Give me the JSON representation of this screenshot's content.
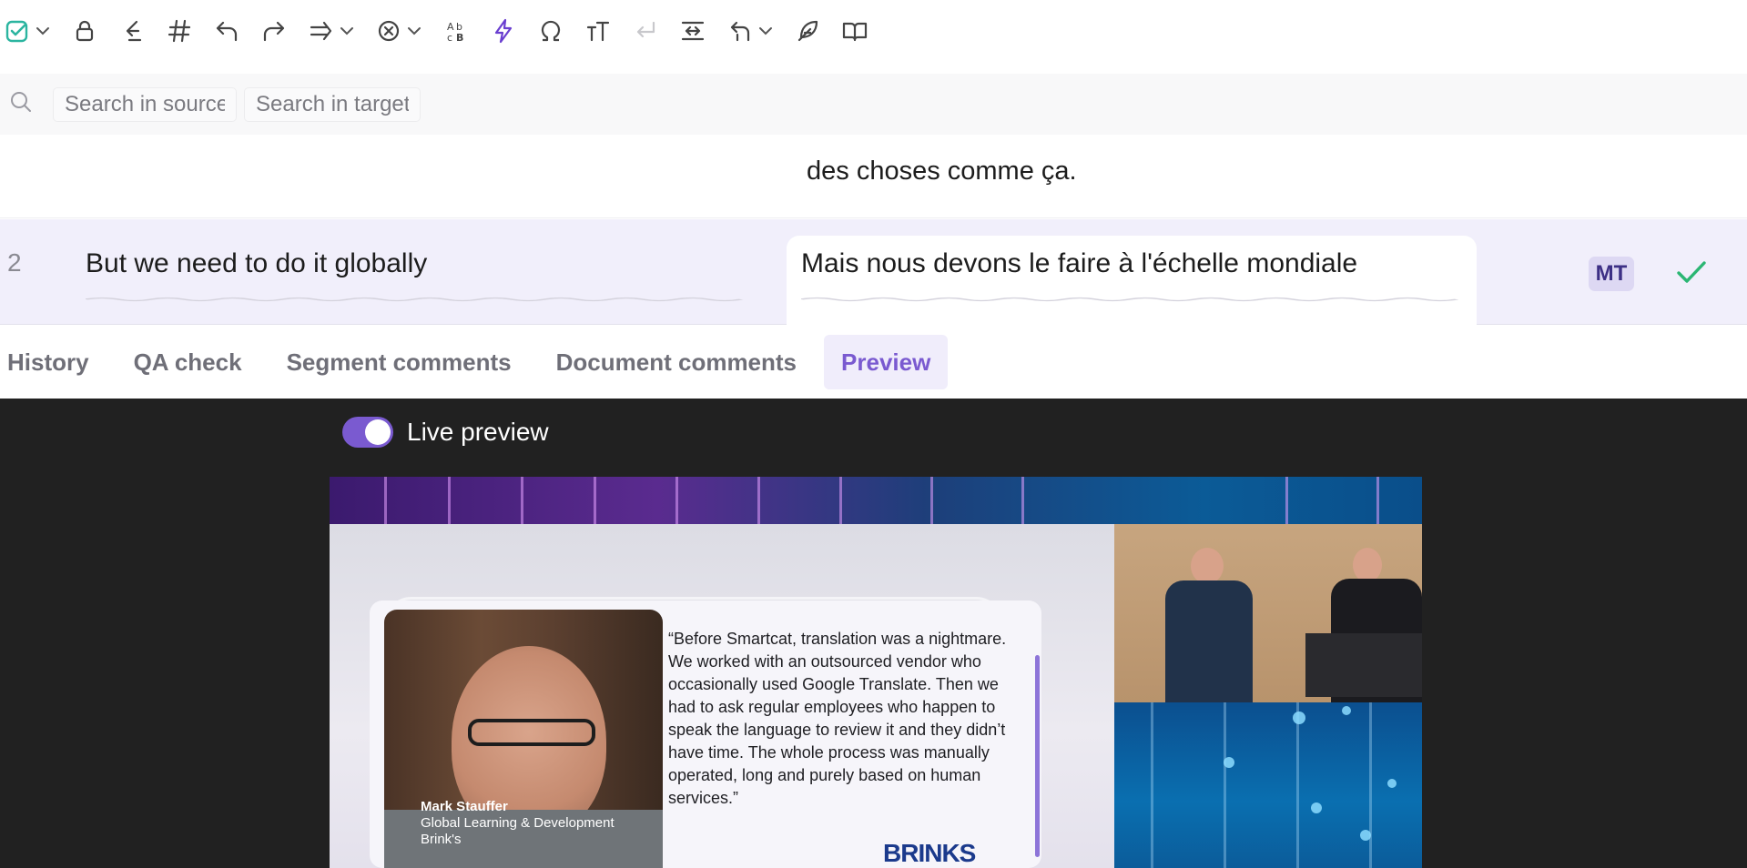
{
  "toolbar": {
    "icons": [
      "confirm-icon",
      "lock-icon",
      "insert-source-icon",
      "hashtag-icon",
      "undo-icon",
      "redo-icon",
      "tags-icon",
      "clear-icon",
      "case-icon",
      "lightning-icon",
      "omega-icon",
      "text-size-icon",
      "line-break-icon",
      "merge-icon",
      "revert-icon",
      "feather-icon",
      "book-icon"
    ]
  },
  "search": {
    "source_placeholder": "Search in source",
    "target_placeholder": "Search in target"
  },
  "segments": [
    {
      "target": "des choses comme ça."
    },
    {
      "number": "2",
      "source": "But we need to do it globally",
      "target": "Mais nous devons le faire à l'échelle mondiale",
      "badge": "MT",
      "status": "confirmed"
    }
  ],
  "tabs": [
    {
      "label": "History",
      "active": false
    },
    {
      "label": "QA check",
      "active": false
    },
    {
      "label": "Segment comments",
      "active": false
    },
    {
      "label": "Document comments",
      "active": false
    },
    {
      "label": "Preview",
      "active": true
    }
  ],
  "preview": {
    "live_preview_label": "Live preview",
    "live_preview_on": true,
    "slide": {
      "person_name": "Mark Stauffer",
      "person_role": "Global Learning & Development",
      "person_company": "Brink's",
      "quote": "“Before Smartcat, translation was a nightmare. We worked with an outsourced vendor who occasionally used Google Translate. Then we had to ask regular employees who happen to speak the language to review it and they didn’t have time. The whole process was manually operated, long and purely based on human services.”",
      "brand": "BRINKS"
    }
  },
  "colors": {
    "accent": "#7a5ad0",
    "confirm": "#2bb673",
    "highlight_row": "#f1effb"
  }
}
